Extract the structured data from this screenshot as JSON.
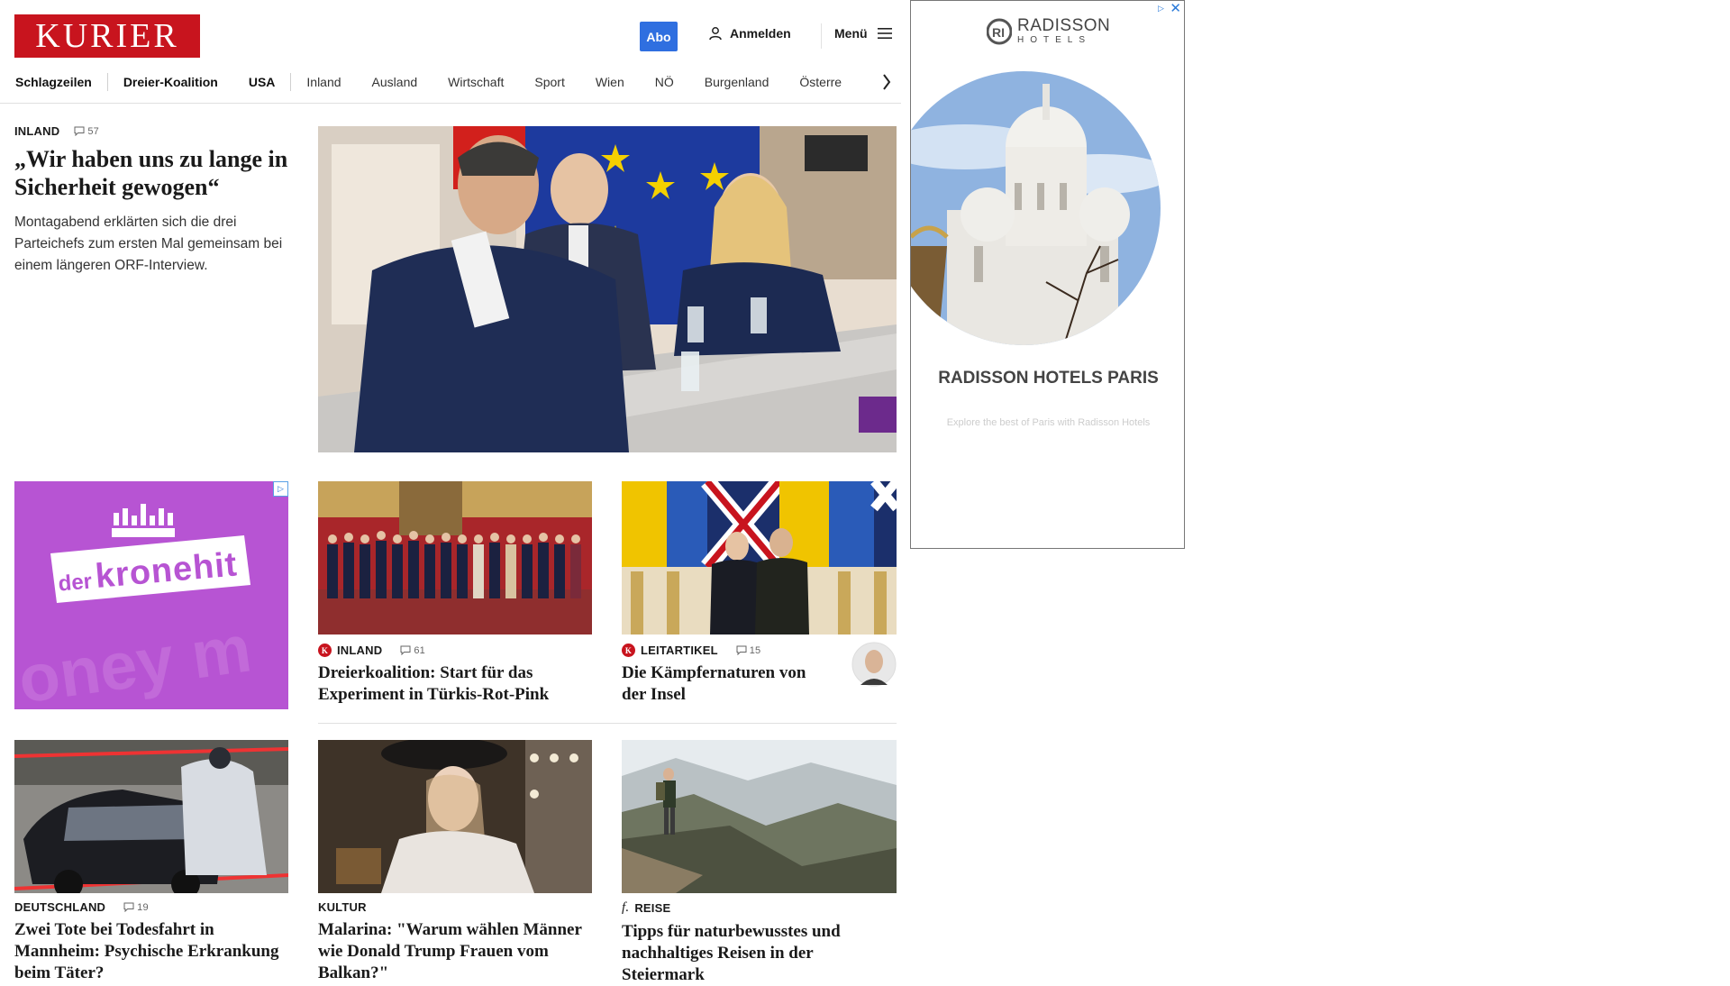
{
  "header": {
    "logo": "KURIER",
    "abo_label": "Abo",
    "login_label": "Anmelden",
    "menu_label": "Menü"
  },
  "nav": {
    "items": [
      "Schlagzeilen",
      "Dreier-Koalition",
      "USA",
      "Inland",
      "Ausland",
      "Wirtschaft",
      "Sport",
      "Wien",
      "NÖ",
      "Burgenland",
      "Österre"
    ]
  },
  "lead": {
    "kicker": "INLAND",
    "comments": "57",
    "title": "„Wir haben uns zu lange in Sicherheit gewogen“",
    "teaser": "Montagabend erklärten sich die drei Parteichefs zum ersten Mal gemeinsam bei einem längeren ORF-Interview."
  },
  "ad_left": {
    "brand_pre": "der",
    "brand_main": "kronehit",
    "bg_text": "oney m"
  },
  "cards": [
    {
      "kicker": "INLAND",
      "comments": "61",
      "title": "Dreierkoalition: Start für das Experiment in Türkis-Rot-Pink"
    },
    {
      "kicker": "LEITARTIKEL",
      "comments": "15",
      "title": "Die Kämpfernaturen von der Insel"
    },
    {
      "kicker": "DEUTSCHLAND",
      "comments": "19",
      "title": "Zwei Tote bei Todesfahrt in Mannheim: Psychische Erkrankung beim Täter?"
    },
    {
      "kicker": "KULTUR",
      "title": "Malarina: \"Warum wählen Männer wie Donald Trump Frauen vom Balkan?\""
    },
    {
      "kicker": "REISE",
      "title": "Tipps für naturbewusstes und nachhaltiges Reisen in der Steiermark"
    }
  ],
  "ad_right": {
    "brand_line1": "RADISSON",
    "brand_line2": "HOTELS",
    "headline": "RADISSON HOTELS PARIS",
    "sub": "Explore the best of Paris with Radisson Hotels"
  },
  "colors": {
    "brand_red": "#c8141e",
    "abo_blue": "#2f6fe0",
    "ad_purple": "#b754d3"
  }
}
